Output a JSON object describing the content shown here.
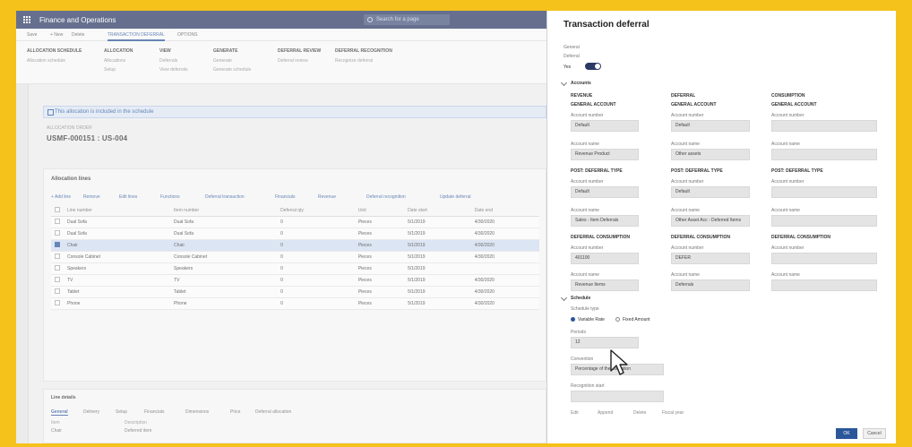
{
  "app": {
    "title": "Finance and Operations",
    "search_placeholder": "Search for a page"
  },
  "actionbar": {
    "items": [
      "Save",
      "+ New",
      "Delete",
      "TRANSACTION DEFERRAL",
      "OPTIONS"
    ],
    "selected": "TRANSACTION DEFERRAL"
  },
  "ribbon": {
    "groups": [
      {
        "title": "ALLOCATION SCHEDULE",
        "items": [
          "Allocation schedule"
        ]
      },
      {
        "title": "ALLOCATION",
        "items": [
          "Allocations",
          "Setup"
        ]
      },
      {
        "title": "VIEW",
        "items": [
          "Deferrals",
          "View deferrals"
        ]
      },
      {
        "title": "GENERATE",
        "items": [
          "Generate",
          "Generate schedule"
        ]
      },
      {
        "title": "DEFERRAL REVIEW",
        "items": [
          "Deferral review"
        ]
      },
      {
        "title": "DEFERRAL RECOGNITION",
        "items": [
          "Recognize deferral"
        ]
      }
    ]
  },
  "main": {
    "banner": "This allocation is included in the schedule",
    "record_caption": "ALLOCATION ORDER",
    "record_title": "USMF-000151 : US-004",
    "lines_caption": "Allocation lines",
    "toolbar": [
      "+ Add line",
      "Remove",
      "Edit lines",
      "Functions",
      "Deferral transaction",
      "Financials",
      "Revenue",
      "Deferral recognition",
      "Update deferral"
    ],
    "columns": [
      "Line number",
      "Item number",
      "Deferral qty",
      "Unit",
      "Date start",
      "Date end"
    ],
    "rows": [
      {
        "item": "Dual Sofa",
        "name": "Dual Sofa",
        "qty": "0",
        "unit": "Pieces",
        "start": "5/1/2019",
        "end": "4/30/2020",
        "selected": false
      },
      {
        "item": "Dual Sofa",
        "name": "Dual Sofa",
        "qty": "0",
        "unit": "Pieces",
        "start": "5/1/2019",
        "end": "4/30/2020",
        "selected": false
      },
      {
        "item": "Chair",
        "name": "Chair",
        "qty": "0",
        "unit": "Pieces",
        "start": "5/1/2019",
        "end": "4/30/2020",
        "selected": true
      },
      {
        "item": "Console Cabinet",
        "name": "Console Cabinet",
        "qty": "0",
        "unit": "Pieces",
        "start": "5/1/2019",
        "end": "4/30/2020",
        "selected": false
      },
      {
        "item": "Speakers",
        "name": "Speakers",
        "qty": "0",
        "unit": "Pieces",
        "start": "5/1/2019",
        "end": "",
        "selected": false
      },
      {
        "item": "TV",
        "name": "TV",
        "qty": "0",
        "unit": "Pieces",
        "start": "5/1/2019",
        "end": "4/30/2020",
        "selected": false
      },
      {
        "item": "Tablet",
        "name": "Tablet",
        "qty": "0",
        "unit": "Pieces",
        "start": "5/1/2019",
        "end": "4/30/2020",
        "selected": false
      },
      {
        "item": "Phone",
        "name": "Phone",
        "qty": "0",
        "unit": "Pieces",
        "start": "5/1/2019",
        "end": "4/30/2020",
        "selected": false
      }
    ],
    "lower_caption": "Line details",
    "lower_tabs": [
      "General",
      "Delivery",
      "Setup",
      "Financials",
      "Dimensions",
      "Price",
      "Deferral allocation"
    ],
    "lower_kv": [
      {
        "label": "Item",
        "value": "Chair"
      },
      {
        "label": "Description",
        "value": "Deferred item"
      }
    ]
  },
  "panel": {
    "title": "Transaction deferral",
    "general_label": "General",
    "deferral_label": "Deferral",
    "toggle_value": "Yes",
    "accounts_section": "Accounts",
    "col_headers": [
      "REVENUE",
      "DEFERRAL",
      "CONSUMPTION"
    ],
    "col_sub": [
      "GENERAL ACCOUNT",
      "GENERAL ACCOUNT",
      "GENERAL ACCOUNT"
    ],
    "row1_labels": [
      "Account number",
      "Account number",
      "Account number"
    ],
    "row1_values": [
      "Default",
      "Default",
      ""
    ],
    "row2_labels": [
      "Account name",
      "Account name",
      "Account name"
    ],
    "row2_values": [
      "Revenue Product",
      "Other assets",
      ""
    ],
    "mid_headers": [
      "POST: DEFERRAL TYPE",
      "POST: DEFERRAL TYPE",
      "POST: DEFERRAL TYPE"
    ],
    "row3_labels": [
      "Account number",
      "Account number",
      "Account number"
    ],
    "row3_values": [
      "Default",
      "Default",
      ""
    ],
    "row4_labels": [
      "Account name",
      "Account name",
      "Account name"
    ],
    "row4_values": [
      "Sales - Item Deferrals",
      "Other Asset Acc - Deferred Items",
      ""
    ],
    "low_headers": [
      "DEFERRAL CONSUMPTION",
      "DEFERRAL CONSUMPTION",
      "DEFERRAL CONSUMPTION"
    ],
    "row5_labels": [
      "Account number",
      "Account number",
      "Account number"
    ],
    "row5_values": [
      "401100",
      "DEFER",
      ""
    ],
    "row6_labels": [
      "Account name",
      "Account name",
      "Account name"
    ],
    "row6_values": [
      "Revenue Items",
      "Deferrals",
      ""
    ],
    "schedule_section": "Schedule",
    "schedule_type_label": "Schedule type",
    "radio_options": [
      "Variable Rate",
      "Fixed Amount"
    ],
    "periods_label": "Periods",
    "periods_value": "12",
    "convention_label": "Convention",
    "convention_value": "Percentage of the allocation",
    "start_label": "Recognition start",
    "actions": [
      "Edit",
      "Append",
      "Delete",
      "Fiscal year"
    ],
    "ok_label": "OK",
    "cancel_label": "Cancel"
  }
}
